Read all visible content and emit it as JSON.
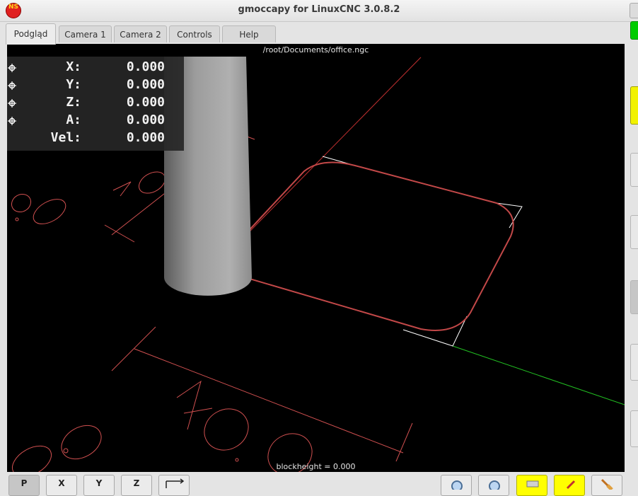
{
  "window": {
    "title": "gmoccapy for LinuxCNC  3.0.8.2",
    "app_icon_text": "NS"
  },
  "tabs": [
    "Podgląd",
    "Camera 1",
    "Camera 2",
    "Controls",
    "Help"
  ],
  "active_tab": "Podgląd",
  "preview": {
    "file_path": "/root/Documents/office.ngc",
    "blockheight": "blockheight = 0.000"
  },
  "dro": [
    {
      "axis": "X:",
      "value": "0.000",
      "homed_marker": true
    },
    {
      "axis": "Y:",
      "value": "0.000",
      "homed_marker": true
    },
    {
      "axis": "Z:",
      "value": "0.000",
      "homed_marker": true
    },
    {
      "axis": "A:",
      "value": "0.000",
      "homed_marker": true
    },
    {
      "axis": "Vel:",
      "value": "0.000",
      "homed_marker": false
    }
  ],
  "view_buttons": [
    "P",
    "X",
    "Y",
    "Z"
  ],
  "status_indicators": {
    "top": "#00cc00",
    "second": "#f2f200"
  },
  "colors": {
    "background": "#000000",
    "toolpath": "#c24848",
    "x_axis": "#c23030",
    "y_axis": "#22c222",
    "extents": "#ffffff"
  }
}
